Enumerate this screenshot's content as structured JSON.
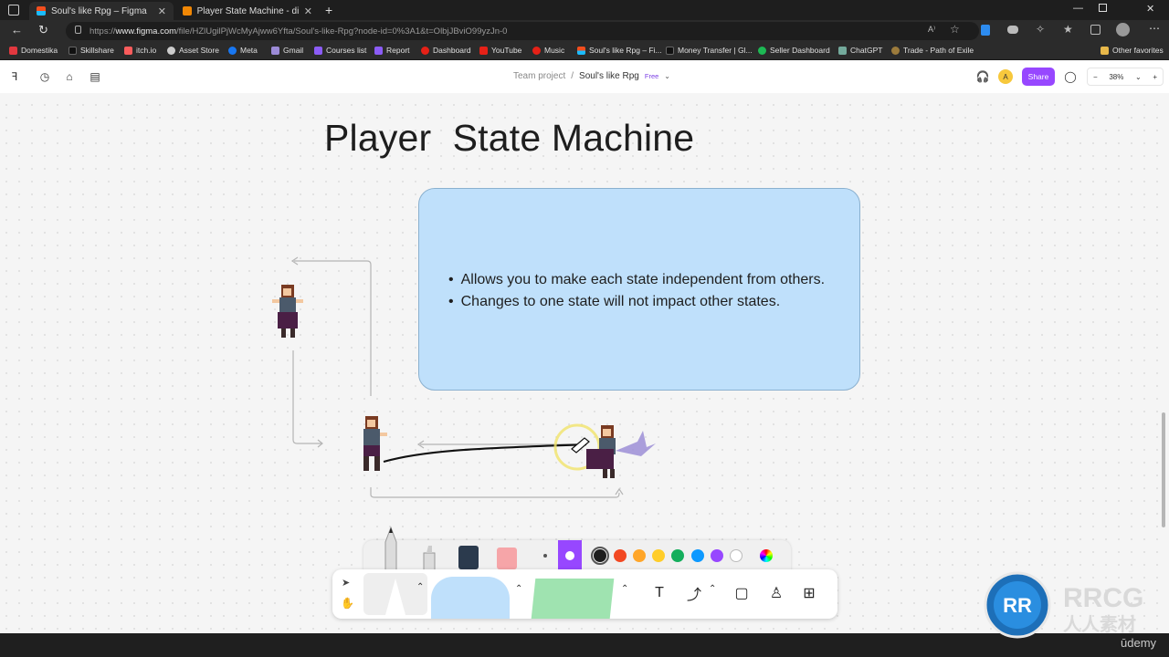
{
  "browser": {
    "tabs": [
      {
        "title": "Soul's like Rpg – Figma",
        "active": true
      },
      {
        "title": "Player State Machine - diagrams.",
        "active": false
      }
    ],
    "url_prefix": "https://",
    "url_host": "www.figma.com",
    "url_path": "/file/HZlUgilPjWcMyAjww6Yfta/Soul's-like-Rpg?node-id=0%3A1&t=OlbjJBviO99yzJn-0",
    "bookmarks": [
      "Domestika",
      "Skillshare",
      "itch.io",
      "Asset Store",
      "Meta",
      "Gmail",
      "Courses list",
      "Report",
      "Dashboard",
      "YouTube",
      "Music",
      "Soul's like Rpg – Fi...",
      "Money Transfer | Gl...",
      "Seller Dashboard",
      "ChatGPT",
      "Trade - Path of Exile"
    ],
    "other_favorites": "Other favorites"
  },
  "figma": {
    "breadcrumb_team": "Team project",
    "breadcrumb_sep": "/",
    "file_name": "Soul's like Rpg",
    "plan_badge": "Free",
    "share_label": "Share",
    "avatar_letter": "A",
    "zoom_minus": "−",
    "zoom_level": "38%",
    "zoom_plus": "+",
    "accent": "#9747ff"
  },
  "board": {
    "title": "Player  State Machine",
    "bullets": [
      "Allows you to make each state independent from others.",
      "Changes to one state will not impact other states."
    ]
  },
  "palette": {
    "colors": [
      "#1e1e1e",
      "#f24822",
      "#ffa629",
      "#ffcd29",
      "#14ae5c",
      "#0d99ff",
      "#9747ff",
      "#ffffff"
    ]
  },
  "toolbar": {
    "text_tool": "T"
  },
  "watermark": {
    "brand": "RRCG",
    "sub": "人人素材",
    "udemy": "ūdemy"
  }
}
